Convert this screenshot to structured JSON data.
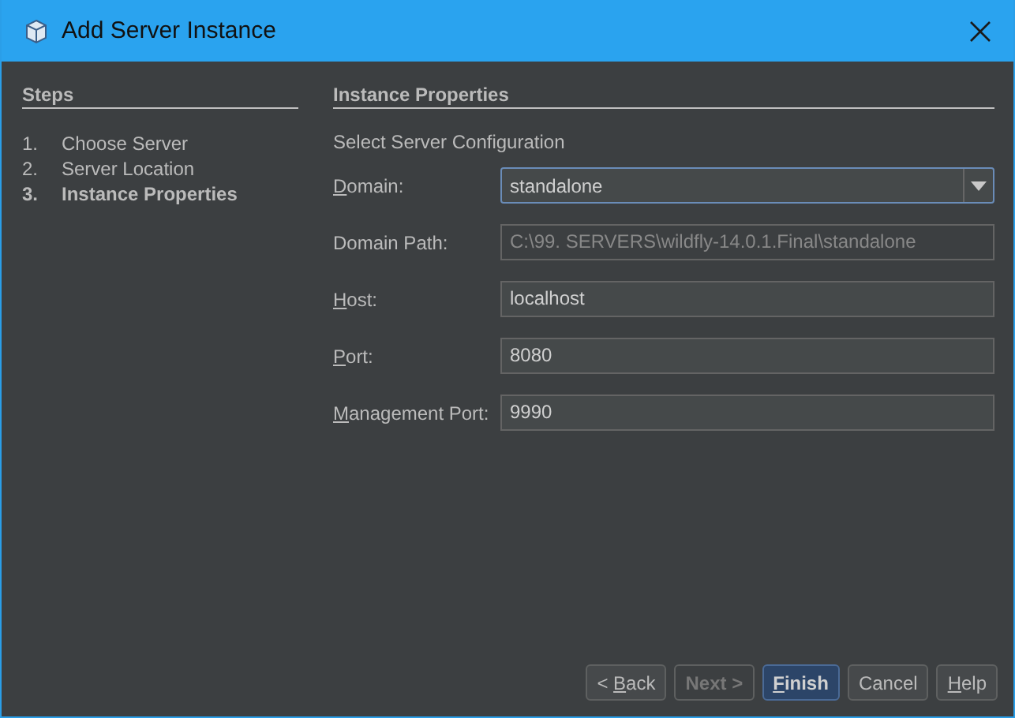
{
  "window": {
    "title": "Add Server Instance"
  },
  "steps": {
    "title": "Steps",
    "items": [
      {
        "number": "1.",
        "label": "Choose Server",
        "selected": false
      },
      {
        "number": "2.",
        "label": "Server Location",
        "selected": false
      },
      {
        "number": "3.",
        "label": "Instance Properties",
        "selected": true
      }
    ]
  },
  "panel": {
    "title": "Instance Properties",
    "subtitle": "Select Server Configuration",
    "fields": [
      {
        "kind": "combo",
        "label": {
          "key": "D",
          "post": "omain:"
        },
        "value": "standalone"
      },
      {
        "kind": "text",
        "label": {
          "pre": "Domain Path:"
        },
        "value": "C:\\99. SERVERS\\wildfly-14.0.1.Final\\standalone",
        "disabled": true
      },
      {
        "kind": "text",
        "label": {
          "key": "H",
          "post": "ost:"
        },
        "value": "localhost",
        "disabled": false
      },
      {
        "kind": "text",
        "label": {
          "key": "P",
          "post": "ort:"
        },
        "value": "8080",
        "disabled": false
      },
      {
        "kind": "text",
        "label": {
          "key": "M",
          "post": "anagement Port:"
        },
        "value": "9990",
        "disabled": false
      }
    ]
  },
  "buttons": [
    {
      "label": {
        "pre": "< ",
        "key": "B",
        "post": "ack"
      },
      "disabled": false,
      "default": false
    },
    {
      "label": {
        "pre": "Next >"
      },
      "disabled": true,
      "default": false
    },
    {
      "label": {
        "key": "F",
        "post": "inish"
      },
      "disabled": false,
      "default": true
    },
    {
      "label": {
        "pre": "Cancel"
      },
      "disabled": false,
      "default": false
    },
    {
      "label": {
        "key": "H",
        "post": "elp"
      },
      "disabled": false,
      "default": false
    }
  ]
}
